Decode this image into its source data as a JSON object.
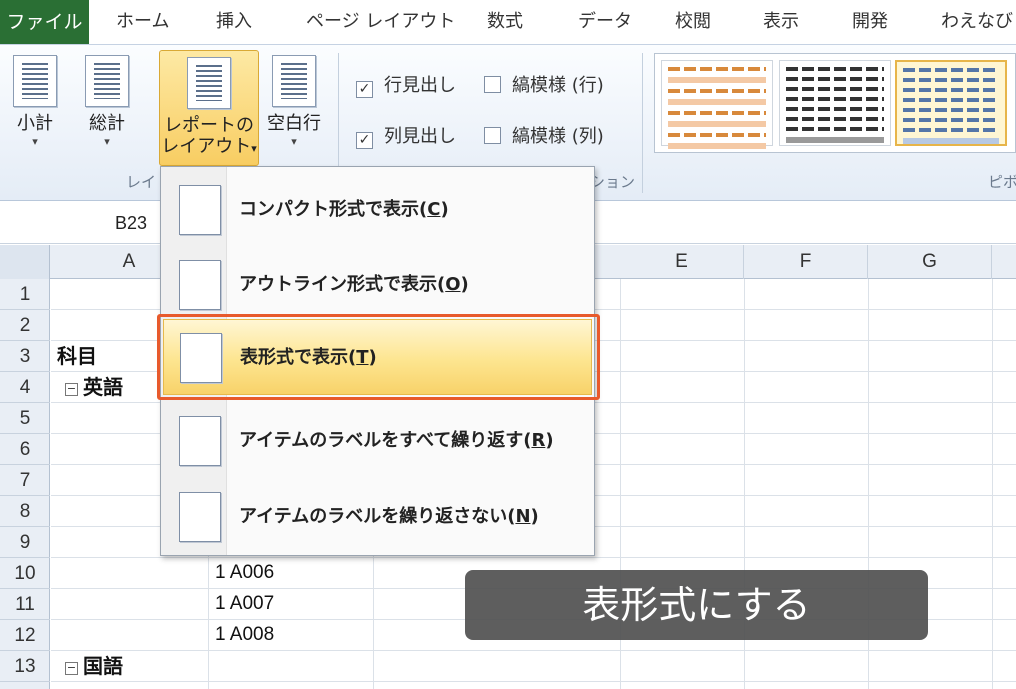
{
  "tabs": {
    "file": "ファイル",
    "home": "ホーム",
    "insert": "挿入",
    "page_layout": "ページ レイアウト",
    "formulas": "数式",
    "data": "データ",
    "review": "校閲",
    "view": "表示",
    "developer": "開発",
    "extra": "わえなび"
  },
  "ribbon": {
    "subtotal": "小計",
    "grand_total": "総計",
    "report_layout_line1": "レポートの",
    "report_layout_line2": "レイアウト",
    "blank_rows": "空白行",
    "caret": "▾",
    "row_headers": "行見出し",
    "column_headers": "列見出し",
    "banded_rows": "縞模様 (行)",
    "banded_columns": "縞模様 (列)",
    "check": "✓",
    "group_layout": "レイ",
    "group_style_options": "ション",
    "group_styles": "ピボ"
  },
  "namebox": "B23",
  "columns": [
    "A",
    "E",
    "F",
    "G"
  ],
  "rows": [
    "1",
    "2",
    "3",
    "4",
    "5",
    "6",
    "7",
    "8",
    "9",
    "10",
    "11",
    "12",
    "13"
  ],
  "cells": {
    "a3": "科目",
    "a4": "英語",
    "a13": "国語",
    "r10": "1 A006",
    "r11": "1 A007",
    "r12": "1 A008",
    "minus": "−"
  },
  "menu": {
    "compact_text": "コンパクト形式で表示(",
    "compact_key": "C",
    "outline_text": "アウトライン形式で表示(",
    "outline_key": "O",
    "tabular_text": "表形式で表示(",
    "tabular_key": "T",
    "repeat_text": "アイテムのラベルをすべて繰り返す(",
    "repeat_key": "R",
    "norepeat_text": "アイテムのラベルを繰り返さない(",
    "norepeat_key": "N",
    "close": ")"
  },
  "caption": "表形式にする",
  "colors": {
    "file_tab": "#2a6f34",
    "highlight_border": "#e85a2c",
    "hover_fill": "#fde58f"
  }
}
